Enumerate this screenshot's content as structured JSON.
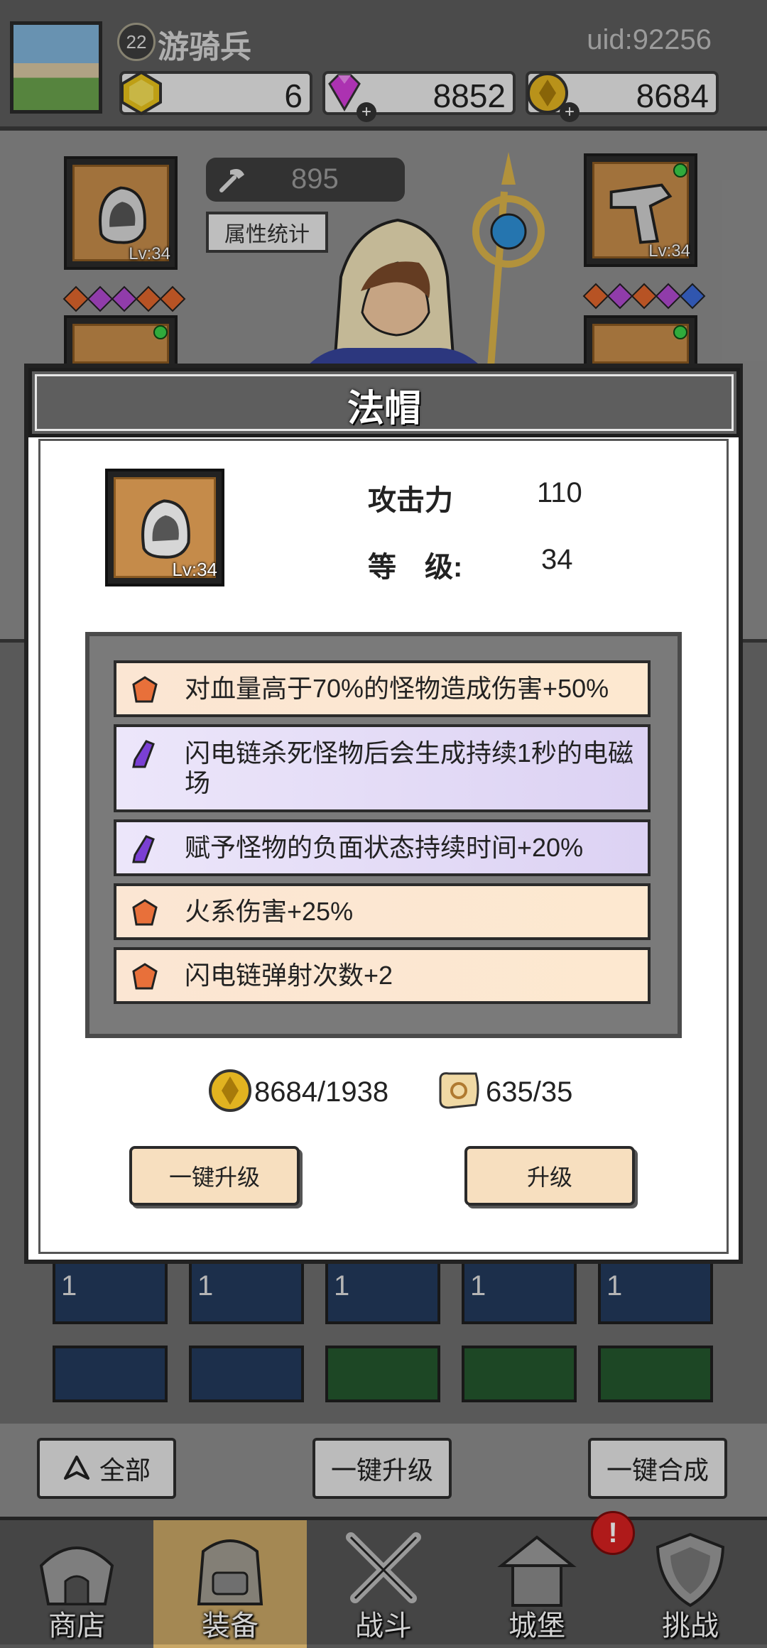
{
  "header": {
    "player_level": "22",
    "player_name": "游骑兵",
    "uid": "uid:92256",
    "resources": [
      {
        "icon": "yellow-gem-icon",
        "value": "6"
      },
      {
        "icon": "diamond-icon",
        "value": "8852"
      },
      {
        "icon": "gold-coin-icon",
        "value": "8684"
      }
    ]
  },
  "equipment": {
    "left_top_level": "Lv:34",
    "right_top_level": "Lv:34",
    "power_value": "895",
    "stats_button": "属性统计",
    "left_gems": [
      "#e0662c",
      "#b04ad0",
      "#b04ad0",
      "#e0662c",
      "#e0662c"
    ],
    "right_gems": [
      "#e0662c",
      "#b04ad0",
      "#e0662c",
      "#b04ad0",
      "#3b6ad6"
    ]
  },
  "modal": {
    "title": "法帽",
    "item_level": "Lv:34",
    "attack_label": "攻击力",
    "attack_value": "110",
    "level_label": "等　级:",
    "level_value": "34",
    "affixes": [
      {
        "color": "orange",
        "text": "对血量高于70%的怪物造成伤害+50%"
      },
      {
        "color": "purple",
        "text": "闪电链杀死怪物后会生成持续1秒的电磁场"
      },
      {
        "color": "purple",
        "text": "赋予怪物的负面状态持续时间+20%"
      },
      {
        "color": "orange",
        "text": "火系伤害+25%"
      },
      {
        "color": "orange",
        "text": "闪电链弹射次数+2"
      }
    ],
    "gold_cost": "8684/1938",
    "scroll_cost": "635/35",
    "upgrade_all_button": "一键升级",
    "upgrade_button": "升级"
  },
  "inventory": {
    "counts": [
      "1",
      "1",
      "1",
      "1",
      "1"
    ]
  },
  "actions": {
    "filter_all": "全部",
    "upgrade_all": "一键升级",
    "merge_all": "一键合成"
  },
  "nav": [
    {
      "label": "商店",
      "icon": "shop-icon"
    },
    {
      "label": "装备",
      "icon": "backpack-icon",
      "active": true
    },
    {
      "label": "战斗",
      "icon": "crossed-swords-icon"
    },
    {
      "label": "城堡",
      "icon": "castle-icon"
    },
    {
      "label": "挑战",
      "icon": "shield-challenge-icon"
    }
  ],
  "alert_badge": "!"
}
